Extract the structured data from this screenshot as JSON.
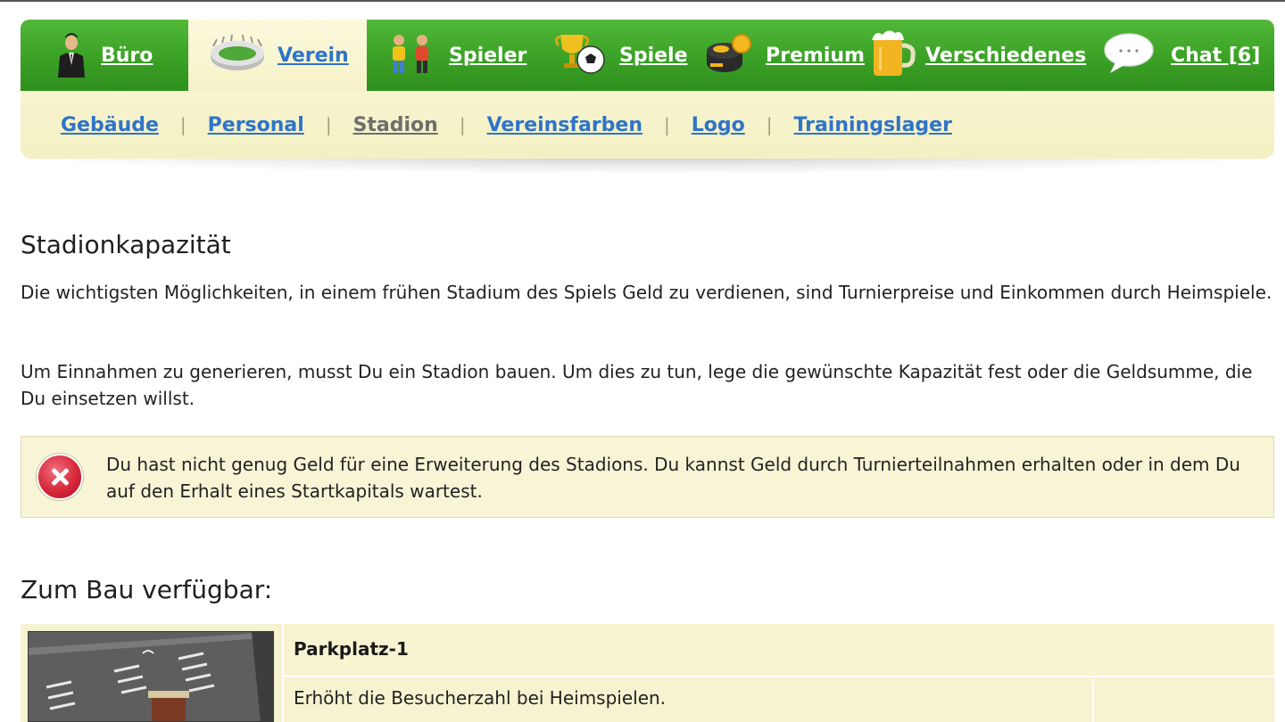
{
  "nav": {
    "tabs": [
      {
        "label": "Büro",
        "icon": "manager-icon"
      },
      {
        "label": "Verein",
        "icon": "stadium-icon",
        "active": true
      },
      {
        "label": "Spieler",
        "icon": "players-icon"
      },
      {
        "label": "Spiele",
        "icon": "trophy-ball-icon"
      },
      {
        "label": "Premium",
        "icon": "coins-icon"
      },
      {
        "label": "Verschiedenes",
        "icon": "beer-icon"
      },
      {
        "label": "Chat [6]",
        "icon": "chat-bubble-icon"
      }
    ],
    "subnav": [
      {
        "label": "Gebäude"
      },
      {
        "label": "Personal"
      },
      {
        "label": "Stadion",
        "current": true
      },
      {
        "label": "Vereinsfarben"
      },
      {
        "label": "Logo"
      },
      {
        "label": "Trainingslager"
      }
    ],
    "separator": "|"
  },
  "main": {
    "heading": "Stadionkapazität",
    "paragraph1": "Die wichtigsten Möglichkeiten, in einem frühen Stadium des Spiels Geld zu verdienen, sind Turnierpreise und Einkommen durch Heimspiele.",
    "paragraph2": "Um Einnahmen zu generieren, musst Du ein Stadion bauen. Um dies zu tun, lege die gewünschte Kapazität fest oder die Geldsumme, die Du einsetzen willst.",
    "alert": {
      "icon": "error-x-icon",
      "text": "Du hast nicht genug Geld für eine Erweiterung des Stadions. Du kannst Geld durch Turnierteilnahmen erhalten oder in dem Du auf den Erhalt eines Startkapitals wartest."
    },
    "available_heading": "Zum Bau verfügbar:",
    "building": {
      "title": "Parkplatz-1",
      "description": "Erhöht die Besucherzahl bei Heimspielen.",
      "image": "parking-lot-image"
    }
  },
  "colors": {
    "nav_green": "#3ea528",
    "nav_cream": "#f6f2c8",
    "link_blue": "#2f74c8",
    "alert_bg": "#f8f5d6",
    "error_red": "#d8283c"
  }
}
